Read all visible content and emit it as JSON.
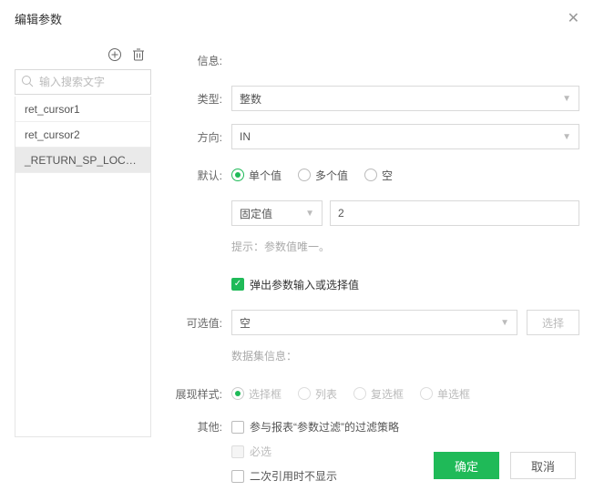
{
  "header": {
    "title": "编辑参数"
  },
  "sidebar": {
    "search_placeholder": "输入搜索文字",
    "items": [
      {
        "label": "ret_cursor1"
      },
      {
        "label": "ret_cursor2"
      },
      {
        "label": "_RETURN_SP_LOCATION_"
      }
    ],
    "selected_index": 2
  },
  "form": {
    "info": {
      "label": "信息:"
    },
    "type": {
      "label": "类型:",
      "value": "整数"
    },
    "direction": {
      "label": "方向:",
      "value": "IN"
    },
    "default": {
      "label": "默认:",
      "options": [
        "单个值",
        "多个值",
        "空"
      ],
      "selected": 0,
      "mode_value": "固定值",
      "input_value": "2",
      "hint": "提示：参数值唯一。",
      "popup_label": "弹出参数输入或选择值",
      "popup_checked": true
    },
    "optional": {
      "label": "可选值:",
      "value": "空",
      "select_btn": "选择",
      "dataset_hint": "数据集信息："
    },
    "display": {
      "label": "展现样式:",
      "options": [
        "选择框",
        "列表",
        "复选框",
        "单选框"
      ],
      "selected": 0
    },
    "other": {
      "label": "其他:",
      "opt1": "参与报表“参数过滤”的过滤策略",
      "opt2": "必选",
      "opt3": "二次引用时不显示"
    }
  },
  "footer": {
    "ok": "确定",
    "cancel": "取消"
  }
}
